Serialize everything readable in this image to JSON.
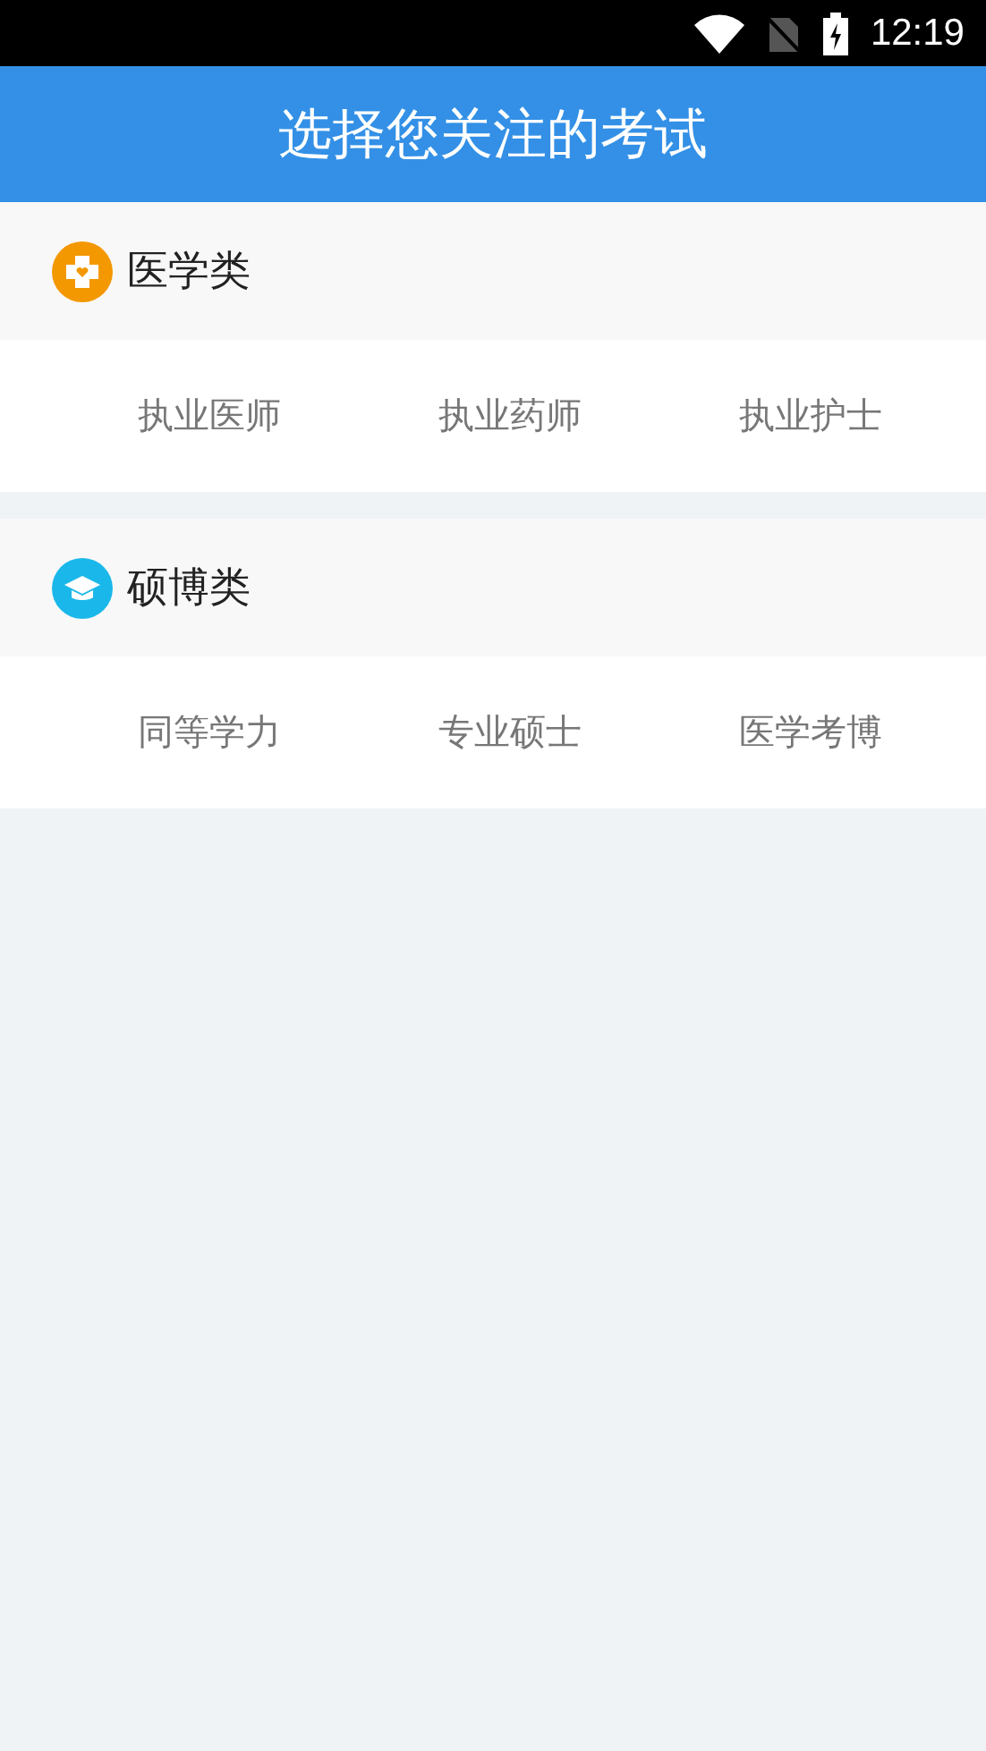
{
  "status_bar": {
    "time": "12:19"
  },
  "header": {
    "title": "选择您关注的考试"
  },
  "categories": [
    {
      "kind": "medical",
      "title": "医学类",
      "exams": [
        "执业医师",
        "执业药师",
        "执业护士"
      ]
    },
    {
      "kind": "graduate",
      "title": "硕博类",
      "exams": [
        "同等学力",
        "专业硕士",
        "医学考博"
      ]
    }
  ]
}
